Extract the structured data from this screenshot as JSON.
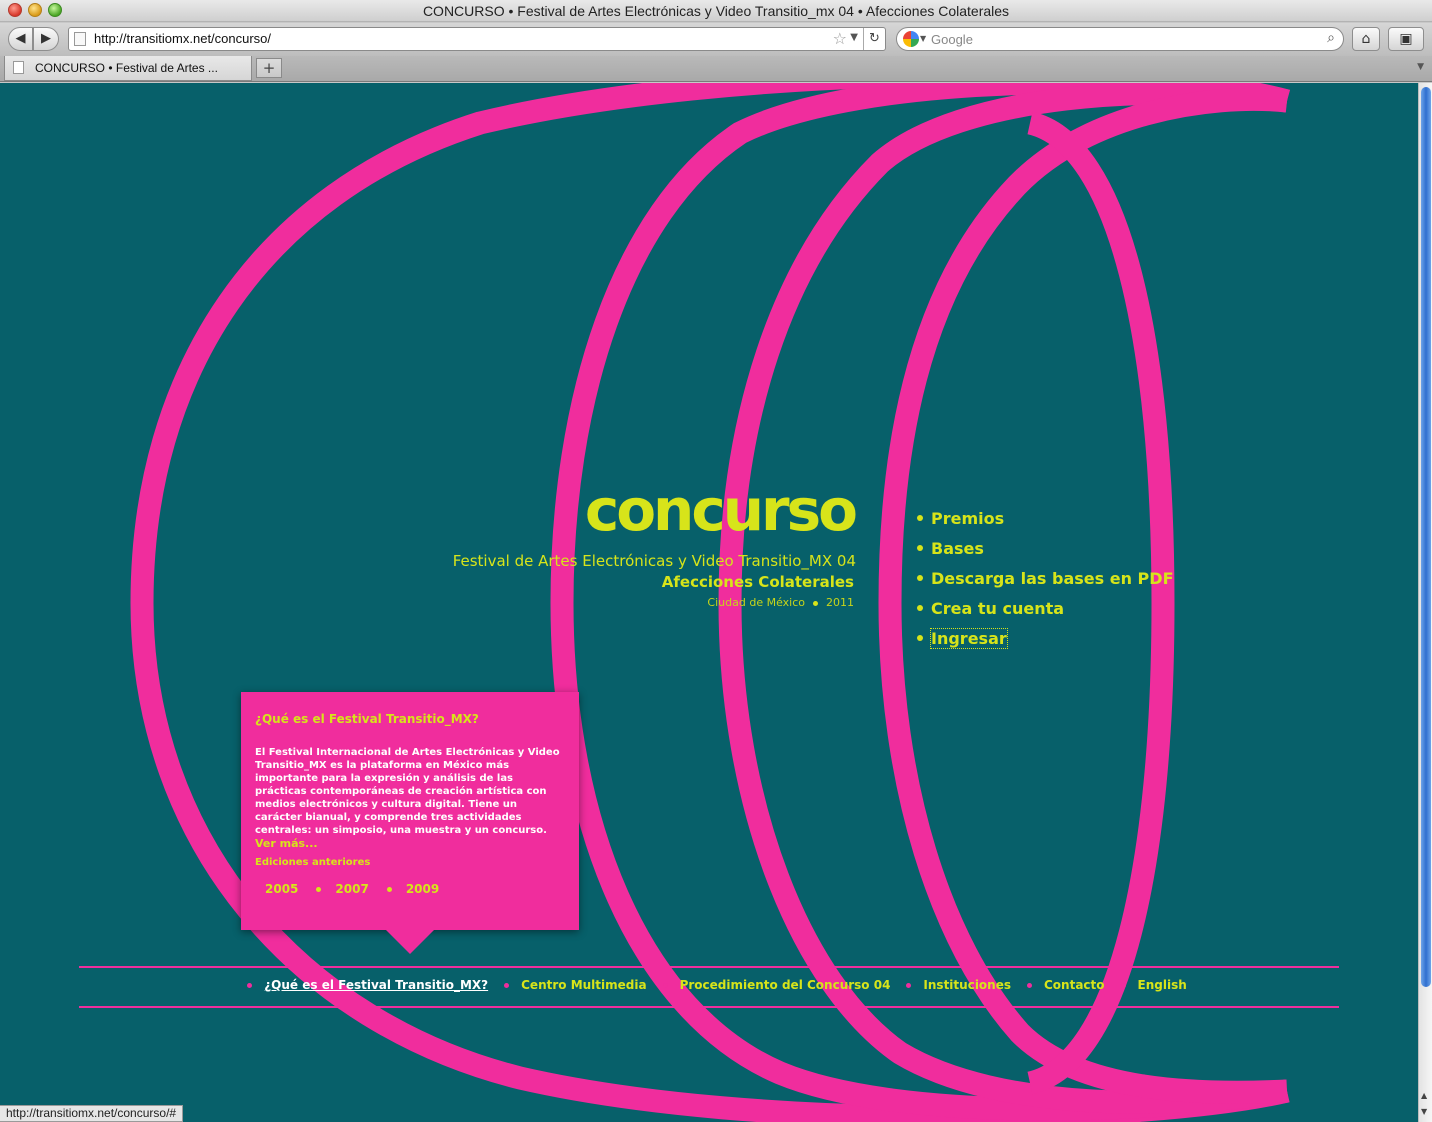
{
  "window": {
    "title": "CONCURSO • Festival de Artes Electrónicas y Video Transitio_mx 04 • Afecciones Colaterales"
  },
  "toolbar": {
    "back_icon": "◀",
    "forward_icon": "▶",
    "url": "http://transitiomx.net/concurso/",
    "star_icon": "☆",
    "dropdown_icon": "▼",
    "reload_icon": "↻",
    "search_placeholder": "Google",
    "search_icon": "⌕",
    "home_icon": "⌂",
    "bookmark_icon": "▣"
  },
  "tabs": {
    "active_label": "CONCURSO • Festival de Artes ...",
    "new_tab_icon": "+",
    "list_icon": "▼"
  },
  "site": {
    "logo": "concurso",
    "festival": "Festival de Artes Electrónicas y Video Transitio_MX 04",
    "edition_name": "Afecciones Colaterales",
    "city": "Ciudad de México",
    "year": "2011"
  },
  "side_menu": [
    {
      "label": "Premios"
    },
    {
      "label": "Bases"
    },
    {
      "label": "Descarga las bases en PDF"
    },
    {
      "label": "Crea tu cuenta"
    },
    {
      "label": "Ingresar"
    }
  ],
  "popup": {
    "title": "¿Qué es el Festival Transitio_MX?",
    "body": "El Festival Internacional de Artes Electrónicas y Video Transitio_MX es la plataforma en México más importante para la expresión y análisis de las prácticas contemporáneas de creación artística con medios electrónicos y cultura digital. Tiene un carácter bianual, y comprende tres actividades centrales: un simposio, una muestra y un concurso.",
    "more_link": "Ver más...",
    "editions_title": "Ediciones anteriores",
    "editions": [
      "2005",
      "2007",
      "2009"
    ]
  },
  "footer_nav": [
    {
      "label": "¿Qué es el Festival Transitio_MX?"
    },
    {
      "label": "Centro Multimedia"
    },
    {
      "label": "Procedimiento del Concurso 04"
    },
    {
      "label": "Instituciones"
    },
    {
      "label": "Contacto"
    },
    {
      "label": "English"
    }
  ],
  "status": {
    "text": "http://transitiomx.net/concurso/#"
  },
  "colors": {
    "background": "#07606a",
    "accent_pink": "#f02d9d",
    "accent_yellow": "#d7e41a"
  }
}
